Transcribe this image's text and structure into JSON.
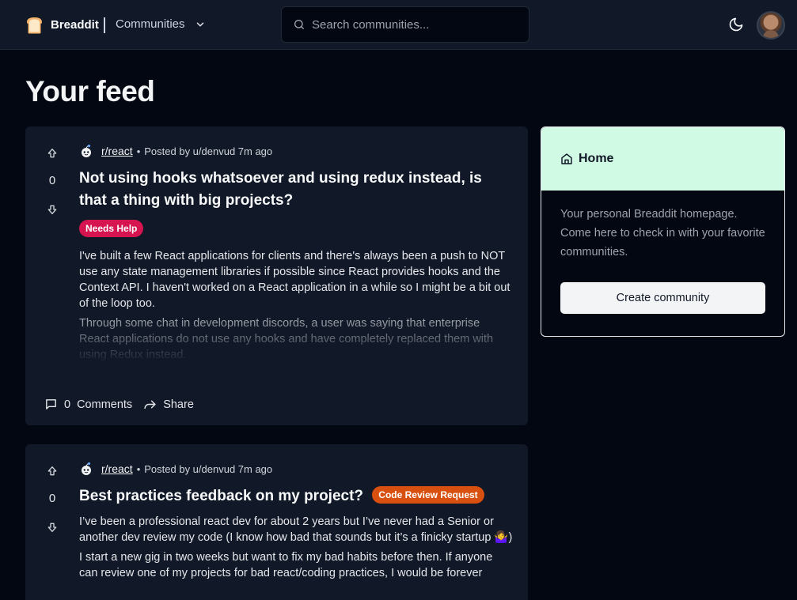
{
  "navbar": {
    "brand_name": "Breaddit",
    "communities_label": "Communities",
    "search_placeholder": "Search communities..."
  },
  "feed": {
    "title": "Your feed",
    "posts": [
      {
        "subreddit": "r/react",
        "posted_by": "Posted by u/denvud 7m ago",
        "votes": "0",
        "title": "Not using hooks whatsoever and using redux instead, is that a thing with big projects?",
        "flair": "Needs Help",
        "paragraphs": [
          "I've built a few React applications for clients and there's always been a push to NOT use any state management libraries if possible since React provides hooks and the Context API. I haven't worked on a React application in a while so I might be a bit out of the loop too.",
          "Through some chat in development discords, a user was saying that enterprise React applications do not use any hooks and have completely replaced them with using Redux instead."
        ],
        "comments_count": "0",
        "comments_label": "Comments",
        "share_label": "Share"
      },
      {
        "subreddit": "r/react",
        "posted_by": "Posted by u/denvud 7m ago",
        "votes": "0",
        "title": "Best practices feedback on my project?",
        "flair": "Code Review Request",
        "paragraphs": [
          "I’ve been a professional react dev for about 2 years but I’ve never had a Senior or another dev review my code (I know how bad that sounds but it’s a finicky startup 🤷‍♀️)",
          "I start a new gig in two weeks but want to fix my bad habits before then. If anyone can review one of my projects for bad react/coding practices, I would be forever"
        ]
      }
    ]
  },
  "sidebar": {
    "home_title": "Home",
    "home_description": "Your personal Breaddit homepage. Come here to check in with your favorite communities.",
    "create_button": "Create community"
  },
  "colors": {
    "background": "#030712",
    "card": "#111827",
    "flair_needs_help": "#d61550",
    "flair_code_review": "#d8500f",
    "home_header": "#d1fae5"
  },
  "icons": [
    "bread-logo-icon",
    "chevron-down-icon",
    "search-icon",
    "moon-icon",
    "upvote-icon",
    "downvote-icon",
    "subreddit-icon",
    "comment-icon",
    "share-icon",
    "home-icon"
  ]
}
